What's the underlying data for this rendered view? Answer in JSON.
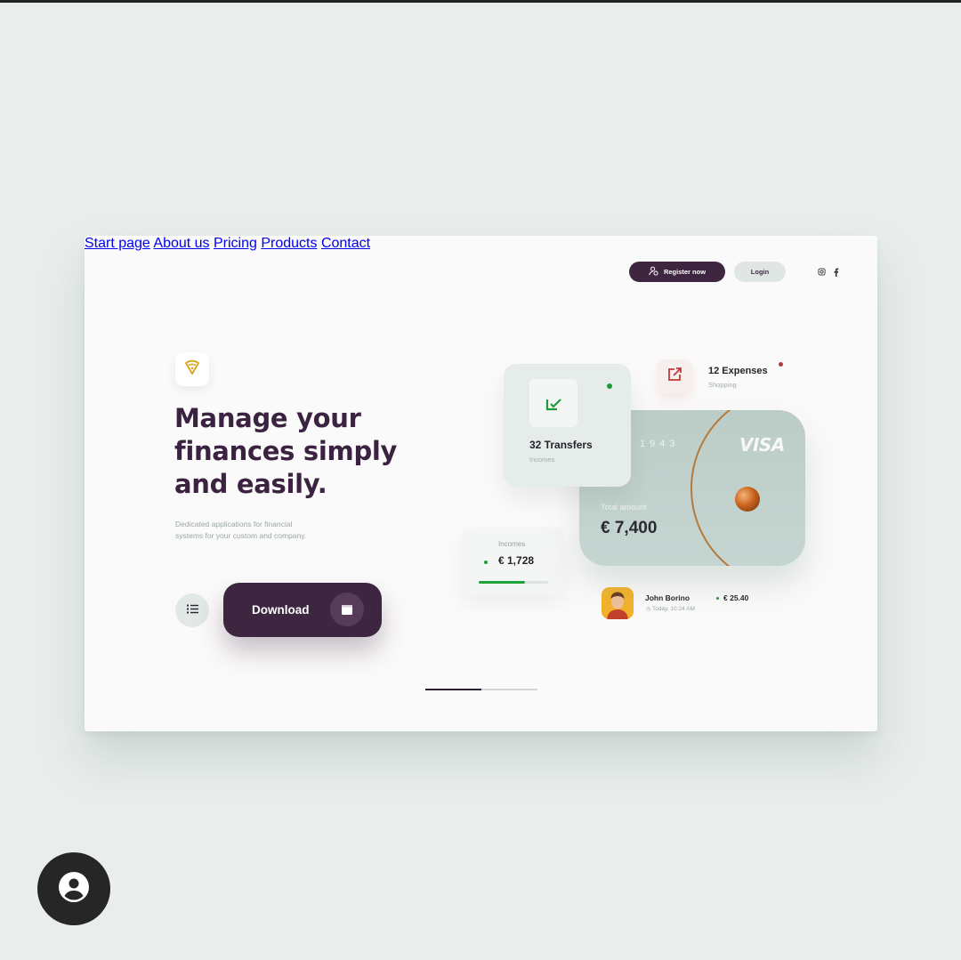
{
  "nav": {
    "items": [
      "Start page",
      "About us",
      "Pricing",
      "Products",
      "Contact"
    ],
    "register_label": "Register now",
    "login_label": "Login",
    "social": [
      "instagram-icon",
      "facebook-icon"
    ]
  },
  "hero": {
    "logo_icon": "pizza-wifi-icon",
    "headline": [
      "Manage your",
      "finances simply",
      "and easily."
    ],
    "subtitle": [
      "Dedicated applications for financial",
      "systems for your custom and company."
    ],
    "download_label": "Download",
    "slider_progress": 0.5
  },
  "cards": {
    "transfers": {
      "title": "32 Transfers",
      "sub": "Incomes"
    },
    "expenses": {
      "title": "12 Expenses",
      "sub": "Shopping"
    },
    "credit_card": {
      "digits": "1943",
      "brand": "VISA",
      "total_label": "Total amount",
      "total_value": "€ 7,400"
    },
    "incomes": {
      "label": "Incomes",
      "value": "€ 1,728",
      "progress": 0.67
    },
    "transaction": {
      "name": "John Borino",
      "time": "Today, 10:24 AM",
      "amount": "€ 25.40"
    }
  },
  "colors": {
    "primary": "#3e2640",
    "accent_green": "#1f9a3a",
    "accent_red": "#b33a3a",
    "card": "#bccdc8"
  }
}
